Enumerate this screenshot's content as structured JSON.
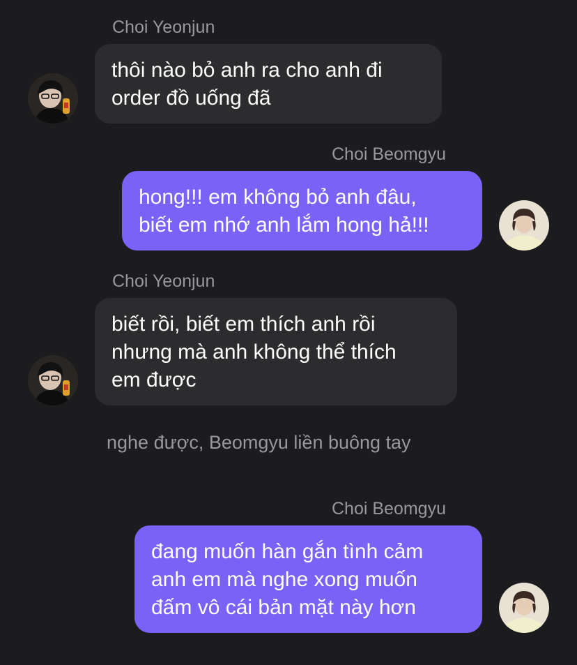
{
  "messages": [
    {
      "sender": "Choi Yeonjun",
      "lines": [
        "thôi nào bỏ anh ra cho anh đi",
        "order đồ uống đã"
      ],
      "avatar_icon": "avatar-yeonjun-icon"
    },
    {
      "sender": "Choi Beomgyu",
      "lines": [
        "hong!!! em không bỏ anh đâu,",
        "biết em nhớ anh lắm hong hả!!!"
      ],
      "avatar_icon": "avatar-beomgyu-icon"
    },
    {
      "sender": "Choi Yeonjun",
      "lines": [
        "biết rồi, biết em thích anh rồi",
        "nhưng mà anh không thể thích",
        "em được"
      ],
      "avatar_icon": "avatar-yeonjun-icon"
    },
    {
      "sender": "Choi Beomgyu",
      "lines": [
        "đang muốn hàn gắn tình cảm",
        "anh em mà nghe xong muốn",
        "đấm vô cái bản mặt này hơn"
      ],
      "avatar_icon": "avatar-beomgyu-icon"
    }
  ],
  "narration": "nghe được, Beomgyu liền buông tay",
  "colors": {
    "background": "#1c1c1e",
    "incoming_bubble": "#2c2c2e",
    "outgoing_bubble": "#7b62f6",
    "sender_text": "#98989d"
  }
}
